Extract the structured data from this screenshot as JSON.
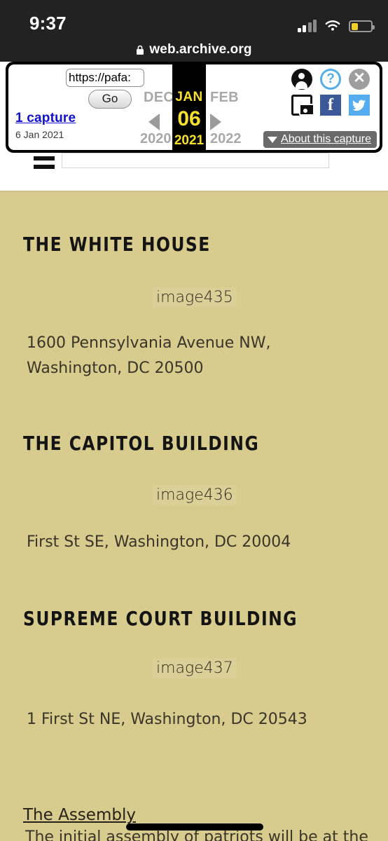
{
  "status_bar": {
    "time": "9:37",
    "signal_icon": "cellular-signal-icon",
    "wifi_icon": "wifi-icon",
    "battery_icon": "battery-low-icon"
  },
  "browser": {
    "lock_icon": "lock-icon",
    "domain": "web.archive.org"
  },
  "wayback_toolbar": {
    "url_value": "https://pafa:",
    "url_placeholder": "https://",
    "go_label": "Go",
    "captures_link": "1 capture",
    "capture_date": "6 Jan 2021",
    "prev_month": "DEC",
    "prev_year": "2020",
    "current_month": "JAN",
    "current_day": "06",
    "current_year": "2021",
    "next_month": "FEB",
    "next_year": "2022",
    "prev_arrow_icon": "arrow-left-icon",
    "next_arrow_icon": "arrow-right-icon",
    "about_label": "About this capture",
    "about_caret_icon": "caret-down-icon",
    "icons": {
      "account": "user-account-icon",
      "help": "help-question-icon",
      "close": "close-x-icon",
      "save": "save-page-camera-icon",
      "facebook": "facebook-icon",
      "twitter": "twitter-icon"
    },
    "help_glyph": "?",
    "close_glyph": "✕",
    "facebook_glyph": "f"
  },
  "site_nav": {
    "menu_icon": "hamburger-menu-icon",
    "field_value": ""
  },
  "page": {
    "background_color": "#d8cb8e",
    "sections": [
      {
        "title": "THE WHITE HOUSE",
        "image_alt": "image435",
        "address": "1600 Pennsylvania Avenue NW, Washington, DC 20500"
      },
      {
        "title": "THE CAPITOL BUILDING",
        "image_alt": "image436",
        "address": "First St SE, Washington, DC 20004"
      },
      {
        "title": "SUPREME COURT BUILDING",
        "image_alt": "image437",
        "address": "1 First St NE, Washington, DC 20543"
      }
    ],
    "assembly": {
      "heading": "The Assembly",
      "body": "The initial assembly of patriots will be at the",
      "redaction_mark": "black-redaction-bar"
    }
  }
}
